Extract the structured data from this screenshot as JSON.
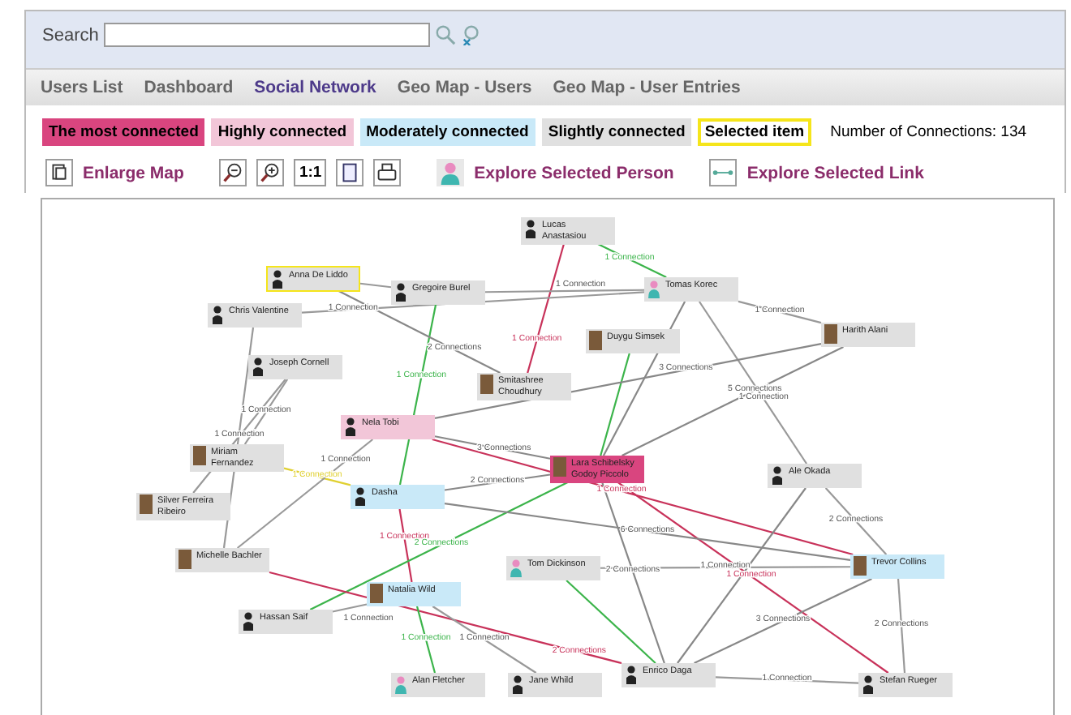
{
  "search": {
    "label": "Search"
  },
  "nav_tabs": [
    {
      "label": "Users List",
      "selected": false
    },
    {
      "label": "Dashboard",
      "selected": false
    },
    {
      "label": "Social Network",
      "selected": true
    },
    {
      "label": "Geo Map - Users",
      "selected": false
    },
    {
      "label": "Geo Map - User Entries",
      "selected": false
    }
  ],
  "legend": [
    {
      "label": "The most connected",
      "kind": "fill",
      "color": "#d9457f"
    },
    {
      "label": "Highly connected",
      "kind": "fill",
      "color": "#f2c6d8"
    },
    {
      "label": "Moderately connected",
      "kind": "fill",
      "color": "#c9e9f8"
    },
    {
      "label": "Slightly connected",
      "kind": "fill",
      "color": "#e0e0e0"
    },
    {
      "label": "Selected item",
      "kind": "outline",
      "color": "#f5e51b"
    }
  ],
  "connections_count": "Number of Connections: 134",
  "toolbar": {
    "enlarge": "Enlarge Map",
    "actual_size": "1:1",
    "explore_person": "Explore Selected Person",
    "explore_link": "Explore Selected Link"
  },
  "graph": {
    "nodes": [
      {
        "name": "Lucas Anastasiou",
        "color": "#e0e0e0",
        "kind": "silhouette",
        "selected": false
      },
      {
        "name": "Anna De Liddo",
        "color": "#e0e0e0",
        "kind": "silhouette",
        "selected": true
      },
      {
        "name": "Gregoire Burel",
        "color": "#e0e0e0",
        "kind": "silhouette",
        "selected": false
      },
      {
        "name": "Tomas Korec",
        "color": "#e0e0e0",
        "kind": "default",
        "selected": false
      },
      {
        "name": "Chris Valentine",
        "color": "#e0e0e0",
        "kind": "silhouette",
        "selected": false
      },
      {
        "name": "Harith Alani",
        "color": "#e0e0e0",
        "kind": "photo",
        "selected": false
      },
      {
        "name": "Duygu Simsek",
        "color": "#e0e0e0",
        "kind": "photo",
        "selected": false
      },
      {
        "name": "Joseph Cornell",
        "color": "#e0e0e0",
        "kind": "silhouette",
        "selected": false
      },
      {
        "name": "Smitashree Choudhury",
        "color": "#e0e0e0",
        "kind": "photo",
        "selected": false
      },
      {
        "name": "Nela Tobi",
        "color": "#f2c6d8",
        "kind": "silhouette",
        "selected": false
      },
      {
        "name": "Miriam Fernandez",
        "color": "#e0e0e0",
        "kind": "photo",
        "selected": false
      },
      {
        "name": "Lara Schibelsky Godoy Piccolo",
        "color": "#d9457f",
        "kind": "photo",
        "selected": false
      },
      {
        "name": "Ale Okada",
        "color": "#e0e0e0",
        "kind": "silhouette",
        "selected": false
      },
      {
        "name": "Silver Ferreira Ribeiro",
        "color": "#e0e0e0",
        "kind": "photo",
        "selected": false
      },
      {
        "name": "Dasha",
        "color": "#c9e9f8",
        "kind": "silhouette",
        "selected": false
      },
      {
        "name": "Michelle Bachler",
        "color": "#e0e0e0",
        "kind": "photo",
        "selected": false
      },
      {
        "name": "Tom Dickinson",
        "color": "#e0e0e0",
        "kind": "default",
        "selected": false
      },
      {
        "name": "Trevor Collins",
        "color": "#c9e9f8",
        "kind": "photo",
        "selected": false
      },
      {
        "name": "Natalia Wild",
        "color": "#c9e9f8",
        "kind": "photo",
        "selected": false
      },
      {
        "name": "Hassan Saif",
        "color": "#e0e0e0",
        "kind": "silhouette",
        "selected": false
      },
      {
        "name": "Alan Fletcher",
        "color": "#e0e0e0",
        "kind": "default",
        "selected": false
      },
      {
        "name": "Jane Whild",
        "color": "#e0e0e0",
        "kind": "silhouette",
        "selected": false
      },
      {
        "name": "Enrico Daga",
        "color": "#e0e0e0",
        "kind": "silhouette",
        "selected": false
      },
      {
        "name": "Stefan Rueger",
        "color": "#e0e0e0",
        "kind": "silhouette",
        "selected": false
      }
    ],
    "edges": [
      {
        "label": "1 Connection",
        "color": "#3cb44b"
      },
      {
        "label": "1 Connection",
        "color": "#c8325a"
      },
      {
        "color": "#999999"
      },
      {
        "label": "1 Connection",
        "color": "#999999"
      },
      {
        "label": "1 Connection",
        "color": "#999999"
      },
      {
        "label": "1 Connection",
        "color": "#999999"
      },
      {
        "color": "#888888"
      },
      {
        "label": "1 Connection",
        "color": "#999999"
      },
      {
        "label": "1 Connection",
        "color": "#3cb44b"
      },
      {
        "label": "2 Connections",
        "color": "#888888"
      },
      {
        "color": "#3cb44b"
      },
      {
        "label": "3 Connections",
        "color": "#888888"
      },
      {
        "label": "5 Connections",
        "color": "#888888"
      },
      {
        "label": "1 Connection",
        "color": "#999999"
      },
      {
        "label": "3 Connections",
        "color": "#888888"
      },
      {
        "label": "1 Connection",
        "color": "#c8325a"
      },
      {
        "label": "1 Connection",
        "color": "#e0d030"
      },
      {
        "label": "1 Connection",
        "color": "#999999"
      },
      {
        "color": "#999999"
      },
      {
        "label": "1 Connection",
        "color": "#999999"
      },
      {
        "label": "2 Connections",
        "color": "#888888"
      },
      {
        "label": "1 Connection",
        "color": "#c8325a"
      },
      {
        "label": "2 Connections",
        "color": "#3cb44b"
      },
      {
        "label": "1 Connection",
        "color": "#999999"
      },
      {
        "label": "2 Connections",
        "color": "#c8325a"
      },
      {
        "label": "1 Connection",
        "color": "#c8325a"
      },
      {
        "label": "1 Connection",
        "color": "#999999"
      },
      {
        "color": "#3cb44b"
      },
      {
        "label": "2 Connections",
        "color": "#888888"
      },
      {
        "color": "#888888"
      },
      {
        "label": "3 Connections",
        "color": "#888888"
      },
      {
        "label": "2 Connections",
        "color": "#999999"
      },
      {
        "label": "1 Connection",
        "color": "#999999"
      },
      {
        "label": "1 Connection",
        "color": "#999999"
      },
      {
        "label": "1 Connection",
        "color": "#3cb44b"
      },
      {
        "label": "2 Connections",
        "color": "#999999"
      },
      {
        "label": "6 Connections",
        "color": "#888888"
      }
    ]
  }
}
